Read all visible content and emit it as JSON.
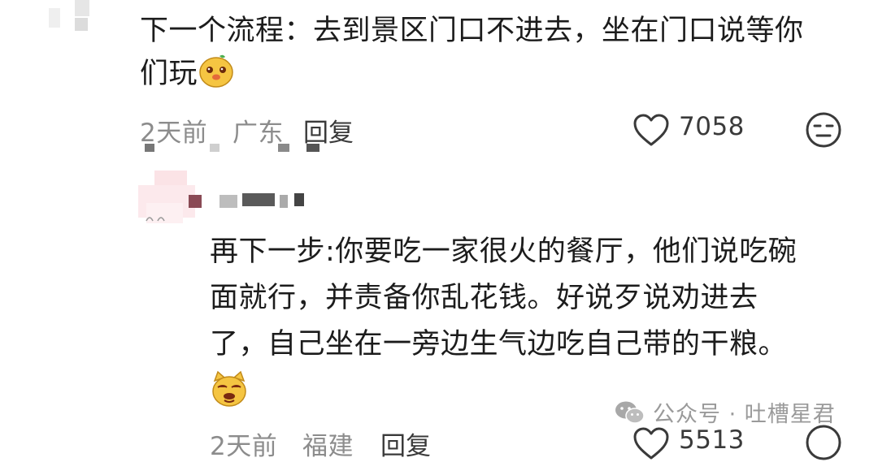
{
  "comment1": {
    "line1": "下一个流程：去到景区门口不进去，坐在门口说等你",
    "line2": "们玩",
    "emoji": "dog-face-emoji",
    "time": "2天前",
    "location": "广东",
    "reply_label": "回复",
    "like_count": "7058",
    "dislike_icon": "neutral-face-icon"
  },
  "comment2": {
    "line1": "再下一步:你要吃一家很火的餐厅，他们说吃碗",
    "line2": "面就行，并责备你乱花钱。好说歹说劝进去",
    "line3": "了，自己坐在一旁边生气边吃自己带的干粮。",
    "emoji": "smug-dog-emoji",
    "time": "2天前",
    "location": "福建",
    "reply_label": "回复",
    "like_count": "5513"
  },
  "watermark": {
    "text": "公众号 · 吐槽星君",
    "icon": "wechat-icon"
  },
  "colors": {
    "text": "#1c1c1c",
    "meta": "#8c8c8c",
    "emoji_yellow": "#f5c542"
  }
}
